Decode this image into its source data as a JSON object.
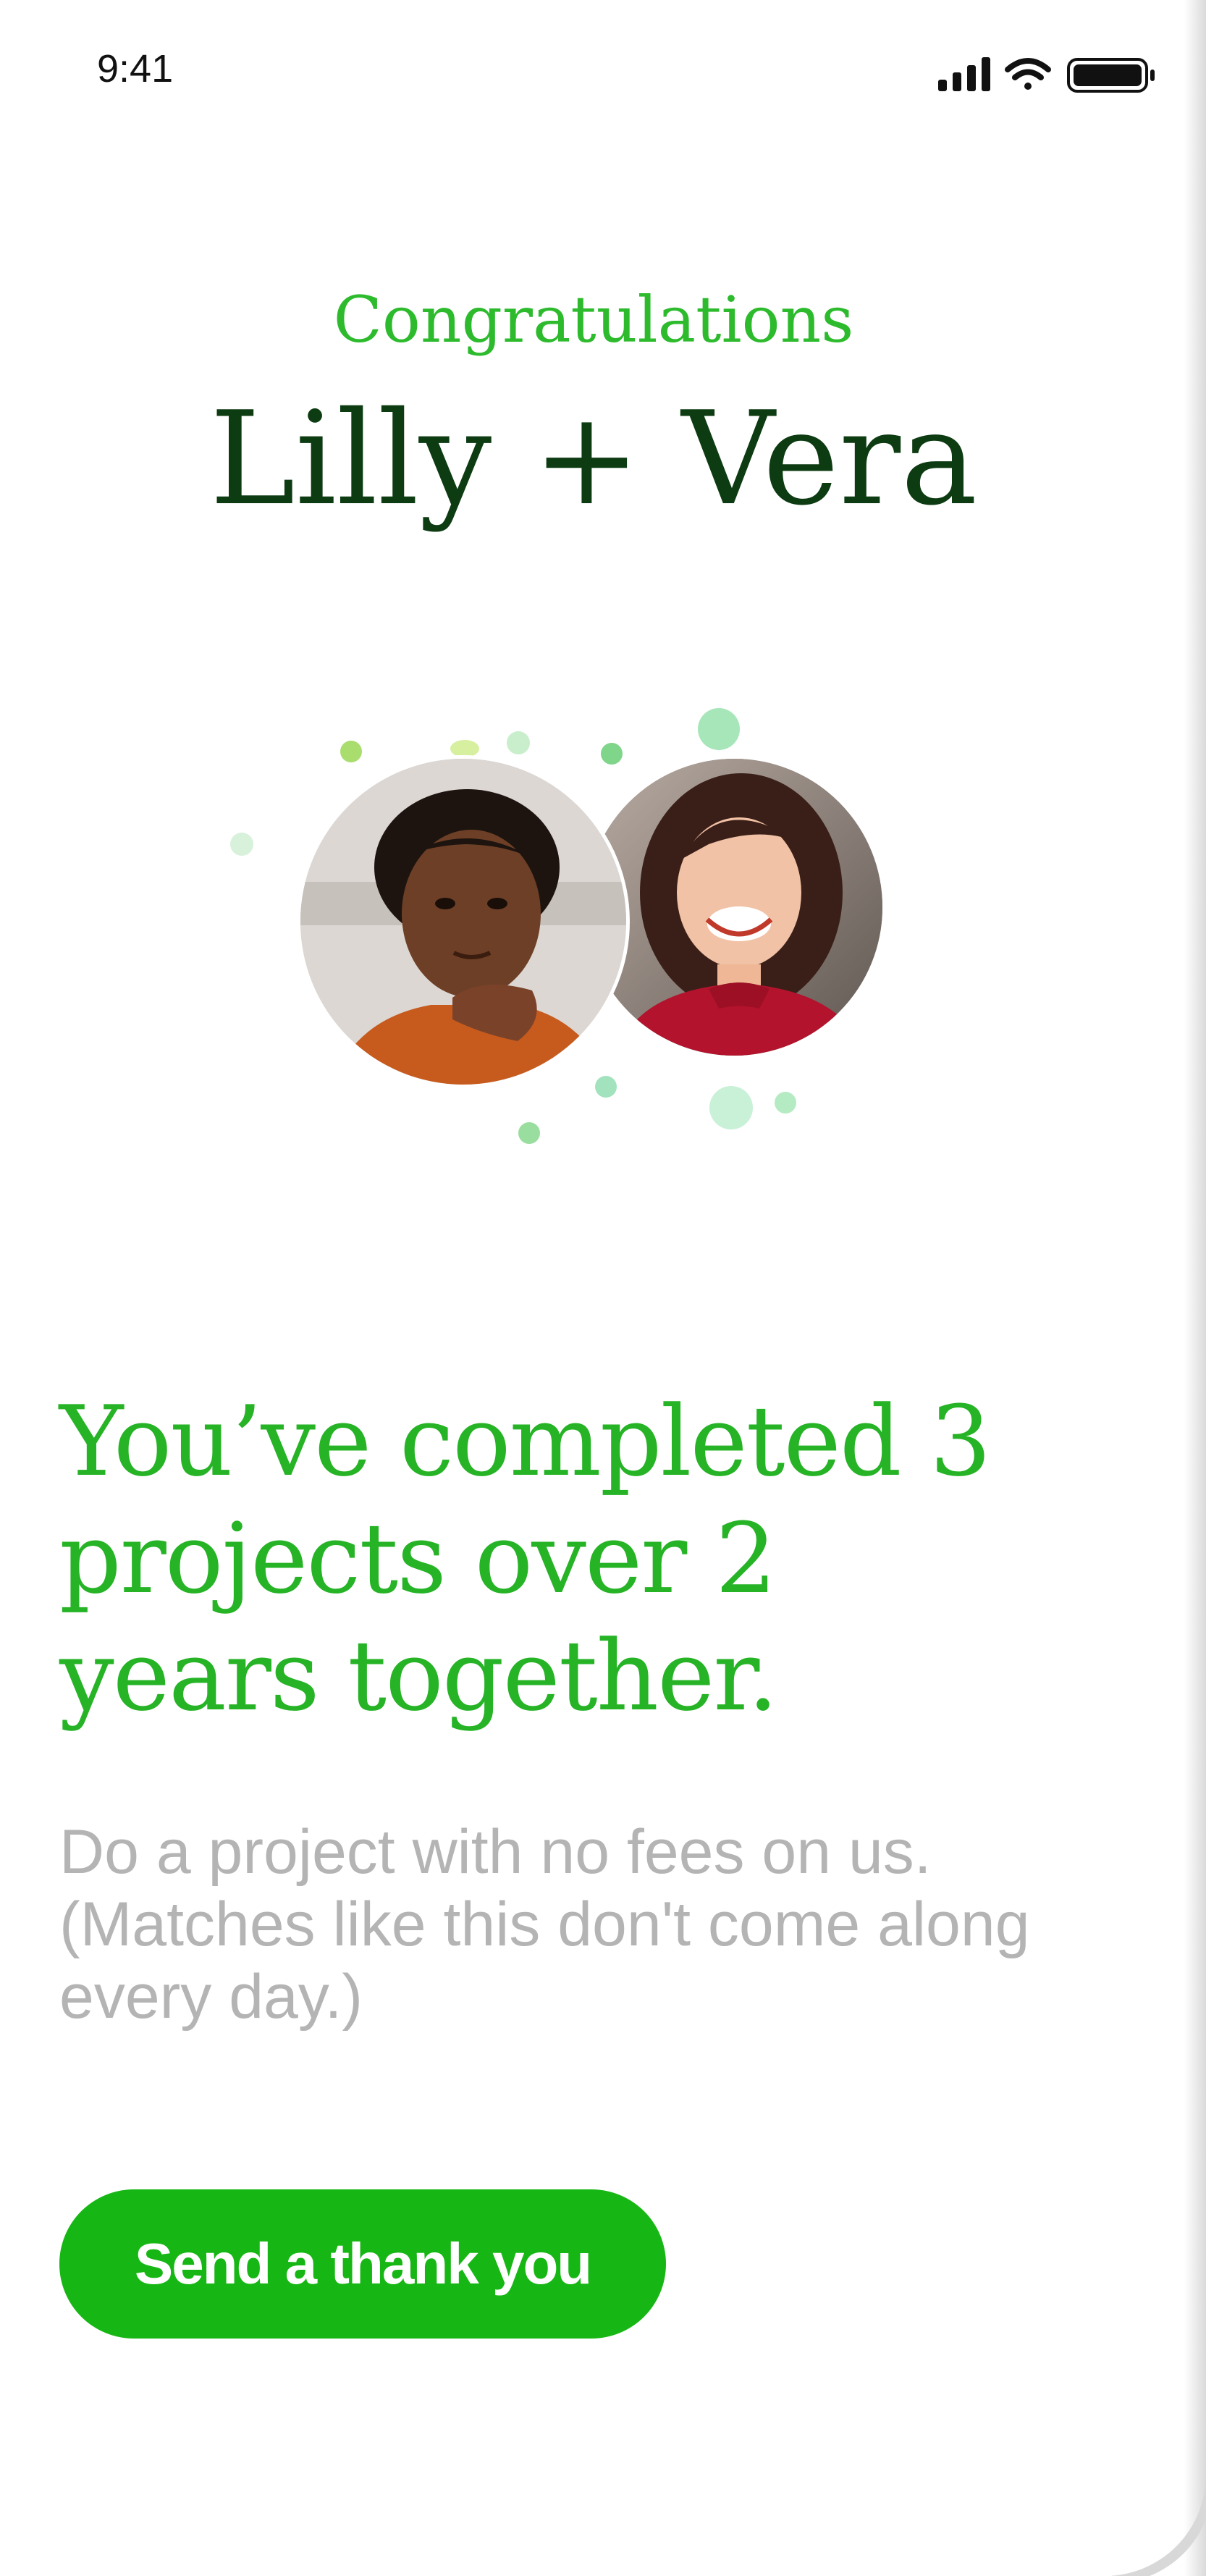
{
  "status_bar": {
    "time": "9:41",
    "icons": [
      "cellular-signal-icon",
      "wifi-icon",
      "battery-icon"
    ]
  },
  "header": {
    "eyebrow": "Congratulations",
    "names": "Lilly + Vera"
  },
  "avatars": [
    {
      "name": "avatar-lilly",
      "icon": "person-portrait"
    },
    {
      "name": "avatar-vera",
      "icon": "person-portrait"
    }
  ],
  "message": {
    "headline_lines": [
      "You’ve completed 3",
      "projects over 2",
      "years together."
    ],
    "body_lines": [
      "Do a project with no fees on us.",
      "(Matches like this don't come along",
      "every day.)"
    ]
  },
  "cta": {
    "label": "Send a thank you"
  },
  "colors": {
    "accent": "#16b714",
    "headline": "#26b326",
    "names": "#0d3b12",
    "body": "#b4b4b4"
  }
}
